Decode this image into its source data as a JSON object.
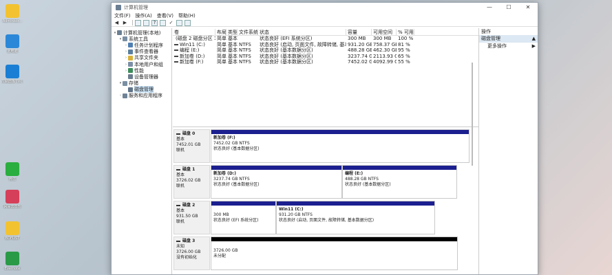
{
  "desktop": {
    "icons": [
      {
        "label": "Administr...",
        "color": "#f2c230"
      },
      {
        "label": "此电脑",
        "color": "#2b88d8"
      },
      {
        "label": "控制面板 (W) ...",
        "color": "#1a7fd4"
      },
      {
        "label": "微信",
        "color": "#2aae3f"
      },
      {
        "label": "网易云音乐",
        "color": "#d63f5a"
      },
      {
        "label": "BDFLIST",
        "color": "#f2c230"
      },
      {
        "label": "Evernote",
        "color": "#2a9a47"
      }
    ]
  },
  "window": {
    "title": "计算机管理",
    "controls": {
      "minimize": "—",
      "maximize": "☐",
      "close": "✕"
    },
    "menu": [
      "文件(F)",
      "操作(A)",
      "查看(V)",
      "帮助(H)"
    ]
  },
  "tree": [
    {
      "label": "计算机管理(本地)",
      "indent": 0,
      "arrow": "▾",
      "color": "#6b7f93"
    },
    {
      "label": "系统工具",
      "indent": 1,
      "arrow": "▾",
      "color": "#7a8fa3"
    },
    {
      "label": "任务计划程序",
      "indent": 2,
      "arrow": "›",
      "color": "#4f7fb3"
    },
    {
      "label": "事件查看器",
      "indent": 2,
      "arrow": "›",
      "color": "#5a7f9e"
    },
    {
      "label": "共享文件夹",
      "indent": 2,
      "arrow": "›",
      "color": "#d9b23a"
    },
    {
      "label": "本地用户和组",
      "indent": 2,
      "arrow": "›",
      "color": "#7c8fa6"
    },
    {
      "label": "性能",
      "indent": 2,
      "arrow": "›",
      "color": "#3c8c5a"
    },
    {
      "label": "设备管理器",
      "indent": 2,
      "arrow": "",
      "color": "#6a7c8e"
    },
    {
      "label": "存储",
      "indent": 1,
      "arrow": "▾",
      "color": "#7a8fa3"
    },
    {
      "label": "磁盘管理",
      "indent": 2,
      "arrow": "",
      "color": "#5f7388",
      "selected": true
    },
    {
      "label": "服务和应用程序",
      "indent": 1,
      "arrow": "›",
      "color": "#6f8396"
    }
  ],
  "volumes": {
    "columns": [
      "卷",
      "布局",
      "类型",
      "文件系统",
      "状态",
      "容量",
      "可用空间",
      "% 可用"
    ],
    "rows": [
      [
        "(磁盘 2 磁盘分区 1)",
        "简单",
        "基本",
        "",
        "状态良好 (EFI 系统分区)",
        "300 MB",
        "300 MB",
        "100 %"
      ],
      [
        "Win11 (C:)",
        "简单",
        "基本",
        "NTFS",
        "状态良好 (启动, 页面文件, 故障转储, 基本数据分区)",
        "931.20 GB",
        "758.37 GB",
        "81 %"
      ],
      [
        "编程 (E:)",
        "简单",
        "基本",
        "NTFS",
        "状态良好 (基本数据分区)",
        "488.28 GB",
        "462.30 GB",
        "95 %"
      ],
      [
        "新加卷 (D:)",
        "简单",
        "基本",
        "NTFS",
        "状态良好 (基本数据分区)",
        "3237.74 GB",
        "2113.93 GB",
        "65 %"
      ],
      [
        "新加卷 (F:)",
        "简单",
        "基本",
        "NTFS",
        "状态良好 (基本数据分区)",
        "7452.02 GB",
        "4092.99 GB",
        "55 %"
      ]
    ]
  },
  "disks": [
    {
      "name": "磁盘 0",
      "type": "基本",
      "size": "7452.01 GB",
      "status": "联机",
      "partitions": [
        {
          "name": "新加卷 (F:)",
          "size": "7452.02 GB NTFS",
          "status": "状态良好 (基本数据分区)",
          "unallocated": false
        }
      ]
    },
    {
      "name": "磁盘 1",
      "type": "基本",
      "size": "3726.02 GB",
      "status": "联机",
      "partitions": [
        {
          "name": "新加卷 (D:)",
          "size": "3237.74 GB NTFS",
          "status": "状态良好 (基本数据分区)",
          "unallocated": false
        },
        {
          "name": "编程 (E:)",
          "size": "488.28 GB NTFS",
          "status": "状态良好 (基本数据分区)",
          "unallocated": false
        }
      ]
    },
    {
      "name": "磁盘 2",
      "type": "基本",
      "size": "931.50 GB",
      "status": "联机",
      "partitions": [
        {
          "name": "",
          "size": "300 MB",
          "status": "状态良好 (EFI 系统分区)",
          "unallocated": false
        },
        {
          "name": "Win11 (C:)",
          "size": "931.20 GB NTFS",
          "status": "状态良好 (启动, 页面文件, 故障转储, 基本数据分区)",
          "unallocated": false
        }
      ]
    },
    {
      "name": "磁盘 3",
      "type": "未知",
      "size": "3726.00 GB",
      "status": "没有初始化",
      "partitions": [
        {
          "name": "",
          "size": "3726.00 GB",
          "status": "未分配",
          "unallocated": true
        }
      ]
    }
  ],
  "actions": {
    "header": "操作",
    "section": "磁盘管理",
    "items": [
      "更多操作"
    ]
  }
}
